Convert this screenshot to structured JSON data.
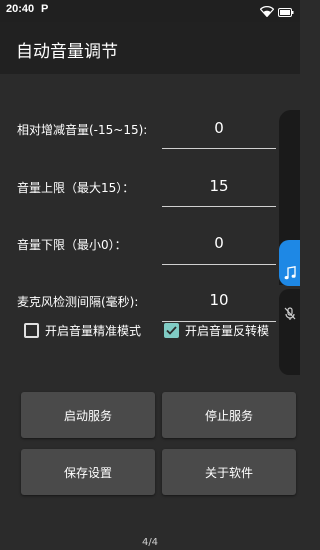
{
  "status_bar": {
    "time": "20:40",
    "app_icon_letter": "P"
  },
  "app_bar": {
    "title": "自动音量调节"
  },
  "settings": [
    {
      "label": "相对增减音量(-15~15):",
      "value": "0"
    },
    {
      "label": "音量上限（最大15）：",
      "value": "15"
    },
    {
      "label": "音量下限（最小0）：",
      "value": "0"
    },
    {
      "label": "麦克风检测间隔(毫秒):",
      "value": "10"
    }
  ],
  "checkboxes": [
    {
      "label": "开启音量精准模式",
      "checked": false
    },
    {
      "label": "开启音量反转模",
      "checked": true
    }
  ],
  "buttons": {
    "start": "启动服务",
    "stop": "停止服务",
    "save": "保存设置",
    "about": "关于软件"
  },
  "page_indicator": "4/4",
  "colors": {
    "background": "#2b2b2b",
    "app_bar": "#212121",
    "button": "#4a4a4a",
    "checkbox_accent": "#80cbc4",
    "floating_accent": "#1e88e5"
  },
  "icons": [
    "wifi-icon",
    "battery-icon",
    "music-note-icon",
    "mic-off-icon",
    "checkmark-icon"
  ]
}
